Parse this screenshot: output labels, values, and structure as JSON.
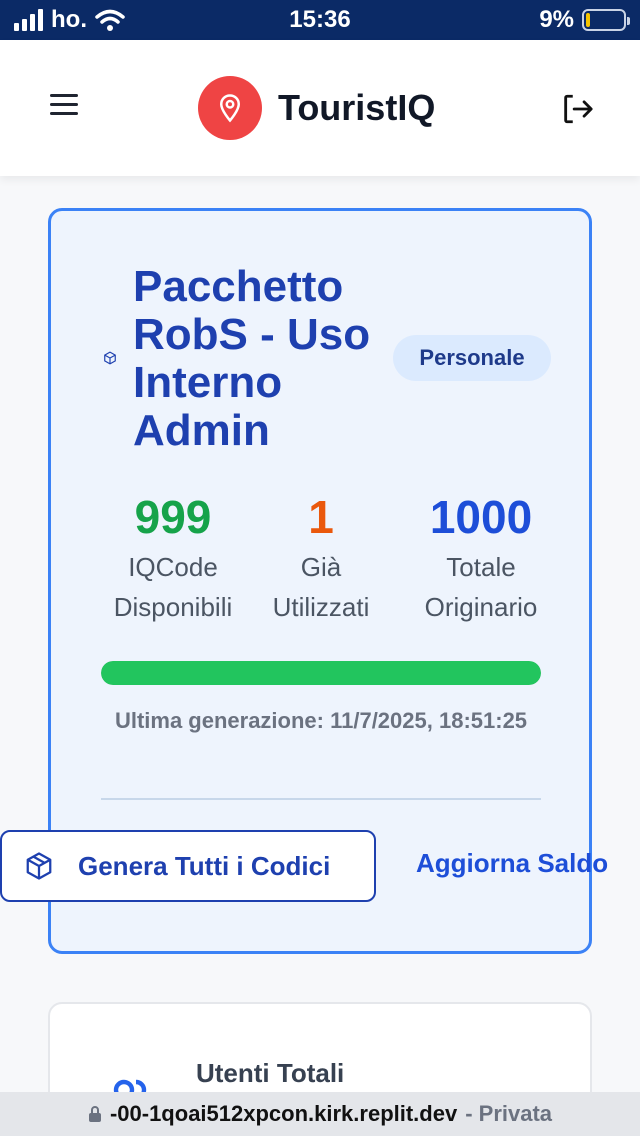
{
  "status_bar": {
    "carrier": "ho.",
    "time": "15:36",
    "battery": "9%"
  },
  "header": {
    "app_name": "TouristIQ",
    "menu_icon": "hamburger-icon",
    "logo_icon": "map-pin-icon",
    "logout_icon": "logout-icon"
  },
  "package": {
    "title": "Pacchetto RobS - Uso Interno Admin",
    "badge": "Personale",
    "stats": [
      {
        "value": "999",
        "label": "IQCode Disponibili",
        "color": "#16a34a"
      },
      {
        "value": "1",
        "label": "Già Utilizzati",
        "color": "#ea580c"
      },
      {
        "value": "1000",
        "label": "Totale Originario",
        "color": "#1d4ed8"
      }
    ],
    "progress_fraction": 1,
    "last_generation": "Ultima generazione: 11/7/2025, 18:51:25",
    "generate_button": "Genera Tutti i Codici",
    "refresh_button": "Aggiorna Saldo"
  },
  "users_card": {
    "label": "Utenti Totali"
  },
  "browser": {
    "url": "-00-1qoai512xpcon.kirk.replit.dev",
    "mode": "- Privata"
  },
  "colors": {
    "accent": "#3b82f6",
    "brand_red": "#ef4444",
    "progress": "#22c55e"
  }
}
